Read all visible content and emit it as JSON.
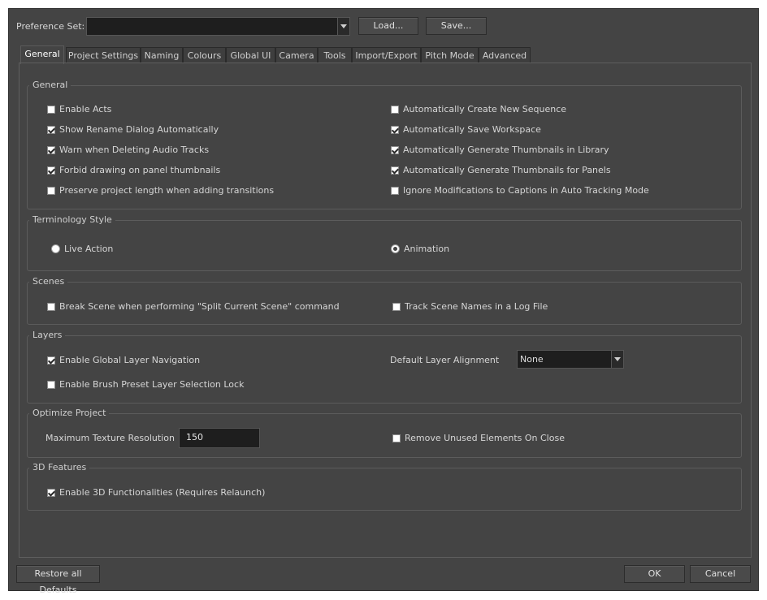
{
  "header": {
    "preference_set_label": "Preference Set:",
    "preference_set_value": "",
    "load_label": "Load...",
    "save_label": "Save..."
  },
  "tabs": [
    {
      "label": "General",
      "active": true
    },
    {
      "label": "Project Settings"
    },
    {
      "label": "Naming"
    },
    {
      "label": "Colours"
    },
    {
      "label": "Global UI"
    },
    {
      "label": "Camera"
    },
    {
      "label": "Tools"
    },
    {
      "label": "Import/Export"
    },
    {
      "label": "Pitch Mode"
    },
    {
      "label": "Advanced"
    }
  ],
  "general": {
    "title": "General",
    "left": [
      {
        "label": "Enable Acts",
        "checked": false
      },
      {
        "label": "Show Rename Dialog Automatically",
        "checked": true
      },
      {
        "label": "Warn when Deleting Audio Tracks",
        "checked": true
      },
      {
        "label": "Forbid drawing on panel thumbnails",
        "checked": true
      },
      {
        "label": "Preserve project length when adding transitions",
        "checked": false
      }
    ],
    "right": [
      {
        "label": "Automatically Create New Sequence",
        "checked": false
      },
      {
        "label": "Automatically Save Workspace",
        "checked": true
      },
      {
        "label": "Automatically Generate Thumbnails in Library",
        "checked": true
      },
      {
        "label": "Automatically Generate Thumbnails for Panels",
        "checked": true
      },
      {
        "label": "Ignore Modifications to Captions in Auto Tracking Mode",
        "checked": false
      }
    ]
  },
  "terminology": {
    "title": "Terminology Style",
    "live_action": "Live Action",
    "animation": "Animation",
    "selected": "live_action"
  },
  "scenes": {
    "title": "Scenes",
    "break_scene": {
      "label": "Break Scene when performing \"Split Current Scene\" command",
      "checked": false
    },
    "track_names": {
      "label": "Track Scene Names in a Log File",
      "checked": false
    }
  },
  "layers": {
    "title": "Layers",
    "global_nav": {
      "label": "Enable Global Layer Navigation",
      "checked": true
    },
    "brush_lock": {
      "label": "Enable Brush Preset Layer Selection Lock",
      "checked": false
    },
    "alignment_label": "Default Layer Alignment",
    "alignment_value": "None"
  },
  "optimize": {
    "title": "Optimize Project",
    "max_texture_label": "Maximum Texture Resolution",
    "max_texture_value": "150",
    "remove_unused": {
      "label": "Remove Unused Elements On Close",
      "checked": false
    }
  },
  "features3d": {
    "title": "3D Features",
    "enable": {
      "label": "Enable 3D Functionalities (Requires Relaunch)",
      "checked": true
    }
  },
  "footer": {
    "restore_label": "Restore all Defaults",
    "ok_label": "OK",
    "cancel_label": "Cancel"
  }
}
